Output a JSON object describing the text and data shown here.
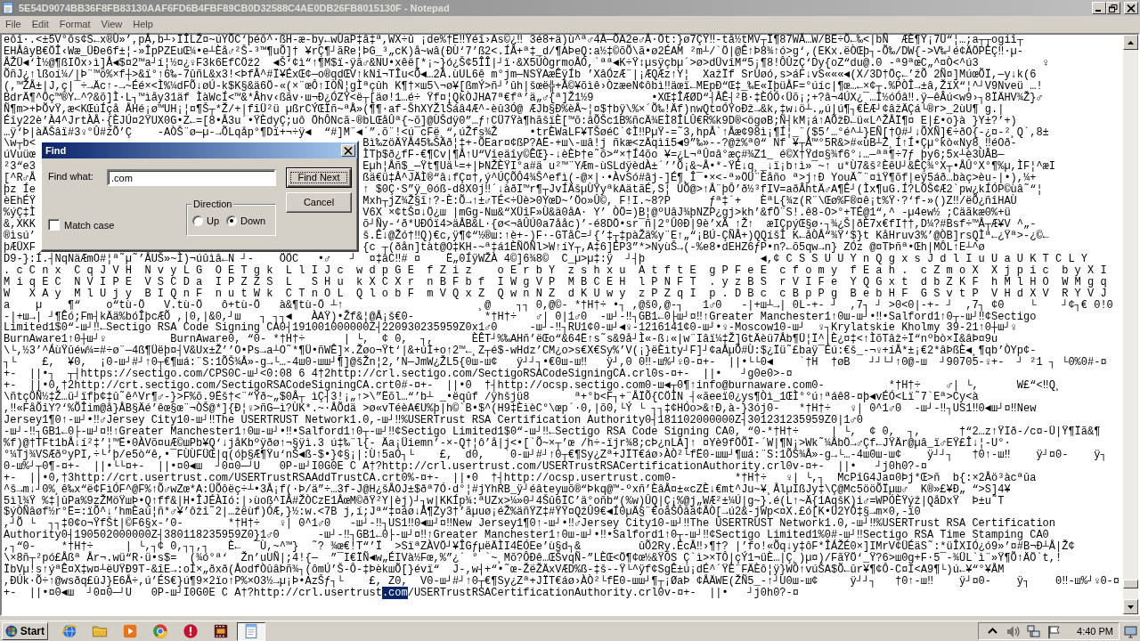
{
  "window": {
    "title": "5E54D9074BB36F8FB83130AAF6FD6B4FBF89CB0D32588C4AE0DB26FB8015130F - Notepad"
  },
  "menu": [
    "File",
    "Edit",
    "Format",
    "View",
    "Help"
  ],
  "editor": {
    "lines": [
      {
        "kind": "text",
        "text": "eôî·.<±5V°ôs¢S←x®Ù»’,pÅ,b┴›ÏÎLŽ¤~úYÕC‘þéô^·ßH-æ-by←wÙaP‡â‡ª,WX÷û ¡de%†E‼Ÿéî›As©¿‼ 3é8+ä)ù^ª♂4Å—ÕA2e♂Å·Öt:}ø7ÇŸ‼-tå½tMV┬Ï¶87WÅ…W/BË÷Õ←‰<|bÑ  ÆÈ¶Ÿ¡7Ü“¦…;a┬┬ogiî┬"
      },
      {
        "kind": "text",
        "text": "EHÅâyB€ÖÎ‹Wæ_ÜÐe6f±¦-»ÎpPZEuŒ¼•e┴Èå♂²Š-³™¶uÕ]† ¥rÇ¶┘ãRe¦ÞG_³„cK)å~wâ(ÐÙ‘7’ß2<.ÍÅ+ª‡_d/¶AÞeQ:a½‡©õÕ\\ã•ø2ÉAM ²m┴/`Ö|@Ê↑Þ8¾↑ó>g‘,(EKx.ëÒŒþ┐-Õ‰/DW{->V‰┘é¢ÄÖPÈÇ‼·µ-"
      },
      {
        "kind": "text",
        "text": "ÅŽÜ◄‘Ì½@¶ßIÖx›ì]Å◄$¤2™a┘í¦½¤¿♀F3k6EfCÖž2  ◄Š‘¢ì“↑¶M$ï-ÿã♂&NU•xêë[*¡~}ó¿Š¢5ÎÎ|┘ï·&X5ÚÒgrmoÅÓ,`ªª◄K÷Ÿ↕µsÿçbµ´>ø>dÜvîM“5¡¶8!ÔÛzÇ‘Dy{oZ“du@.0 -ª9ªœC„^¤Ò<^ú3          ♀"
      },
      {
        "kind": "text",
        "text": "ÕñJ¿↑lßoí¼/|Þ¨™ö%×f┼>&ï°↑6‰-7ûñL&x3!<ÞfÅ^#Ï¥ÉxŒ¢—o®qdŒV↑kNî¬TÎu<Õ◄…2Å.ùUL6ê m°jm—NSŸAæÊÿÍb ’XâÓzÆ¨|¡ÆQÆz↑Y¦  XažÏf SrÙøó,s>áF↓vS«««◄(X/3D†Öç←’žÕ 2Ñ¤]MúœÕÏ,—y↓k(6"
      },
      {
        "kind": "text",
        "text": "(,™ŽÅ±|J,ç|¯÷→Äc↑-→~Éé×<Ì%¼dFÕ↓øÚ-k$K§&ä6Ö-«(×¨œÔ↑IÒÑ¦gÌªçûh K¶†×ш5\\¬ø¥[ßmÝ>ñ┘’ûh|šœë╬+Å©¥õìê›ÒzæeN¢ôbì‼äœï←MEpÐ“Œ‡_‰E«ÏþüÅF=°úíc|¶œ…←×¢┬.%PÒÎ→±â,ŽïX“¦^┘V9Nveü …!"
      },
      {
        "kind": "text",
        "text": "BdrÄ¶^Öç™®Y←^?&õ]Ì·L┐™ìåy31äf ÌàWcÍ<™&*Âhv‹ßãv·ш¬Ð¿ÓZŸ<ë┬[äø!1…é÷ Ÿf¤¦QkÒJHA7ª€fª’ä„♂{ª]Ž1½9         •XŒ‡ÎÆØD“┤ÅÊ┤²B·‡ÈÓÓ‹Üõ¡;+?â¬4ÚX¿¯…Ï½óÓâ‼.ÿ—êÂú<w9›┐8ÏÄHV¾Ž}♂"
      },
      {
        "kind": "text",
        "text": "Ñ¶m>+ÞÕvŸ,æ<KŒúÍçå ÅHé¡ø™UH¡¦¤¶Š┬*Ž/+|fîÜ²ü µßrCÝŒÏñ~ªÅ»(¶¶·af-ŠhXYŽlŠáâ4Æ^-èû3Ó@ ÆJb§Ð%èÅ~¦¤$†bÿ\\%×´Õ‰!Äf)nwQt¤ÓŸoÐž→&k,‡w↓ö┴.„ú|ú¶┐€ÈÆ┘¢âžÄÇá└®r>_2ùU¶ g.|"
      },
      {
        "kind": "text",
        "text": "Éîy22è’À4^JrtÀÅ·{ÈJÚ¤2ŸUX0G•Z←=[8•Å3u´•ŸÈdyÇ;uô ÖhÔNcã-®bLŒåÛª{~õ]@ÙŠdÿ0”…ƒ↑CÜ7Ÿà¶hãšïÈ[™õ:âÕŠc1B%ñcÄ¾EÌ8ÎLÛ€R%k9D®<ögøB;Ñ┤kM¡á↑AÕžÐ←ü«L^ŽÅÏ¶¤ E|£•o}à }Y±?’+)"
      },
      {
        "kind": "text",
        "text": "…ÿ‘Þ|àÄŠâï#3♀°Û#žÕ’Ç    -AÒŠ¨ø—µ-→ÕLqåp°¶Dï+¬÷ÿ◄  “#]M¨◄´”.õ¨!<ú¯cFë¸“,úŽfs¾Ž     •trÈWaLF¥TŠøéC`¢Ì‼PµŸ-=˜3,hpÅ`↑Åæ¢98ì¡¶Í¦_¨($5’…°é^┴}EÑ[†O#┘↓ÕXÑ]€÷ðO{-¿¤-²¸Q`,8±"
      },
      {
        "kind": "split",
        "left": "\\w┬b<",
        "right": "Bì‰zöÄŸÅ45‰ŠÄð¦‡+-ÕEar¤¢ßP?AË-+ш\\-шâ!j ñkæ<zÄqìî5◄9”‰»--?@ž%ª0“ Nf ¥┬Å™°5R&>#«ùB┴Z¸Í↑Í•Çµ°kò«Ny8¸‼éOð-"
      },
      {
        "kind": "split",
        "left": "úVuüœ",
        "right": "ÌTþ$ð¿fF-€¶Cv|¶Å↑U“Vîeäîy©ÊŒ}-↓èÈÞ†e˜õ>“×†Í4õo ¥=¿L¬ªÛ¤â°æç#¾Z1_ é©X†Ÿd¤§¾f6°↓…—ªª¶÷7ƒ þy6;5x┴è3ÙÂB—"
      },
      {
        "kind": "split",
        "left": "²3“e3",
        "right": "Eµh¦Åñ$_—Ÿt¶Uä└=+|ÞNŽÈŸI°a#ä u²™¨YÆm-ùSLdÿèdÀ±´’’Õ¡&~Å•*-ŸÉ↓q¸_↓ï¡b↑ì»¯~↑ u*Ù7&š²ÈêU┘&ÊÇ¾°X┬•ÅÛ°X°¶%µ,ÌF¦^æI"
      },
      {
        "kind": "split",
        "left": "[^R♂Å",
        "right": "ßä€ü‡Å^JÄÌ®“â↓fÇ¤†,ý^ÚÇÕÔ4¾Š^efì(-@×|·•ÀvSó#âj-]É¶¸Î¯•×<-ª»ÖÜ¨Èåño ª>j↑Ð YouÄ˜¨¤ìŸ¶õf|eÿ5áð…bàç>èu-|•),¼+"
      },
      {
        "kind": "split",
        "left": "þz Íe",
        "right": "↑ $0Ç·S”ÿ_0óß-d8X0j‼´↓àðI™r¶┬JvÍÄšµÙŸyªkAätãÉ,S¦ ÙÕ@>↑Å¨þÔ’ð½³fIV=aðÂhtÄ♂A¶Ê┘(Ìx¶uG.Í?LÖŠ¢Æ2`pw¿kÍÓP©ùâ˜“¦"
      },
      {
        "kind": "split",
        "left": "èEhÉŸ",
        "right": "Mxh┬jZ¾Ž§î↑?-È:Õ→↑±♂TÉ<÷Üè>0YœD~’Öo»Û©, F!I.~8?P      ƒª‡´+   ÈªL{¾z(R¨\\Œø%F®¤ê¡t%Ÿ·?‘f-»()Z‼/ëÕ¿ñîHAÙ"
      },
      {
        "kind": "split",
        "left": "%ýÇ‡Ì",
        "right": "V6X ×¢tŠ¤↓Ö¿ш |mGg-Nш&“XÜîF»Ù&ä0åA· Y’ ÒÖ=)B¦@ºUâJ¾þNZP¿gj>kh’&fÖ¨S!.ê8-O>°+TÉ@1“,^ -µ4ew½ ;Cäãkæ0%+ü"
      },
      {
        "kind": "split",
        "left": "&,XKK",
        "right": "õ┘Ñy-‘ð*UÐÓï4>äÅB&L·{ø<¬âÛÚ0a7ååc)’-é8DÖ•sr¯ñ|2°Û0Ð|9è’xÄ ↑Ž↑  æIÇpýŒ§ø·┐¾¿Š|ðÈ7x€fI††,D¼?#Bsf÷™Å┬Æ¥V ^„-"
      },
      {
        "kind": "split",
        "left": "®ìsú’",
        "right": "š.Ê↓@Žó†‼Q)€c,ÿ¶¢“½®ш:↑è+-)F·-GTåC=┘{’‡┬‡pàŽä%y¨E↑„“¡BÚ-ÇÑÂ+)QQíšÌ K←åÒÅ“¾Ÿ‘$}t KåHruv3%’@ÒB]rsQÌª←¿Ÿª>-¿©←"
      },
      {
        "kind": "split",
        "left": "þÆÜXF",
        "right": "{c ┬(ðån]tàt@O‡KH-~ª‡á1ÈÑÖÑl>W↑íY┬,A‡6]ÉP3”*>NyùŠ→(-%e8•dEHZ6ƒP•n?←õ5qw→n} ZÓz @¤TÞñª•Œh|MÔL↑E┴^ø"
      },
      {
        "kind": "text",
        "text": "D9-}:Í.┤NqNäÆmO#¦ª˜µ˜’ÅUŠ»~Ì)¬úûìâ←N ┘-    ÖÖC   •♂   ┘  ¤‡âC‼# ¤    Ë„0ÍÿWŽÀ 4©]6¾8©  C_µ>µ‡:ÿ  ┘┤þ                  ◄,¢ C S S U U Y n Q g x s J d l I u U a U K T C L Y"
      },
      {
        "kind": "text",
        "text": ". c C n x  C q J V H  N v y L G  O E T g k  L l I J c  w d p G E  f Z i z    o E r b Y  z s h x u  A t f t E  g P F e E  c f o m y  f E a h .  c Z m o X  X j p i c  b y X I"
      },
      {
        "kind": "text",
        "text": "M i q E C  N V I P E  V S C D a  I P Z Z S  L   S H u  k X C X r  n B F b f  I W g V P  M B C E H  l P N F T  . y z B S  r V I F e  Y Q G x t  d b Z K F  h M l H O  W M g q"
      },
      {
        "kind": "text",
        "text": "W   X A y  M l U j y  B I Q n F  n u t W k  C T n O L  Q l o b F  m V Q x Z  Q w n N Z  d K U w y  z P Z q I  p . D B c  c B p P g  B e b H F  G S v t P  V H d X V  R Y V J"
      },
      {
        "kind": "text",
        "text": "a    µ    ¶“    o“tù-Ö   V.tù-Ö   ô+tù-Ö   à&¶tù-Ö ┴↑                     ¸@    ┐┐ 0,@©- *†H†÷ •┐ ,@š0,@-┐   1♂0   -|+ш┴→| 0L-+- ┘  ,7┐ ┘ >0<0|-+- ┘  ,7┐ ¢0    └    ┘¢┐€ 0!0"
      },
      {
        "kind": "text",
        "text": "-|+ш→| ┘¶Êó;Fm┤kÄä%bóÎþcÆÕ ,|0,|&0,┘ш   ┐ ┐┐◄   ÀAŸ)•Žf&¦@Å¡š€0-           *†H†÷   ♂| 0|1♂0  -ш┘-‼┐GB1←0├ш┘¤‼↑Greater Manchester1↑0ш-ш┘•‼•Salford1↑0┬-ш┘‼¢Sectigo"
      },
      {
        "kind": "text",
        "text": "Limited1$0“-ш┘‼←Sectigo RSA Code Signing CA0┤191001000000Z┤220930235959Z0x1♂0     -ш┘-‼┐RU1¢0-ш┘◄♀-1216141¢0-ш┘•♀-Moscow10-ш┘  ♀┐Krylatskie Kholmy 39-21↑0┼ш┘♀"
      },
      {
        "kind": "text",
        "text": "BurnAware1↑0┼ш┘♀          BurnAware0, “0- *†H†÷      | └,  ¢ 0,  ┐,      ÈÊT┘%‰AHñ’ëŒo“&64Ë↑s˜s&9å┘Ì«-ß↓«|w¨Iâï¼‡Ž]GtÄèü7Åb¶Ü¦Ï^|È¿¤‡<↑ÌõTâž÷Ï“nºbò×Ï&âÞ¤9u"
      },
      {
        "kind": "text",
        "text": "\\└,½3’^ÁùŸûéw¼=#÷ø¨—4ß¶Üëþ¤┤V&Ux±Ž’’O•Ps→a┴O˜*¶Ü•ñWÊ]×.Žøo¬Ÿt‘|&+úÌ+o↑2™←¸Z┬é$-wHdz’CM¿o>s€X€Sy%’V(¡}ëÈìty┘F]┘¢aÅµÕ#Ù:$¿Ïü˜£baÿ¯Éú:€š_-¬♀+íÅ*±¡€2*âÞßÈ◄¸¶qb’ÒYp¢-"
      },
      {
        "kind": "text",
        "text": "┐└    £,  ¥0,  ¡0-ш┘#┘↑0┬€¶шá:¨S:1ÕŠ¾Å»-g→└…-4ш0-шш┘¶]@šŽn¦2,’N—JmW¿ŽL5{0ш-ш¢   ÿ┘┘┐•€0ш-ш‼   ÿ┘,0 0‼-ш%┘♀0-¤+-  ||•└└0◄    `†H  †øB   ┘┘└┘↑0@-ш  ┘90705-♀+-  ┘ ²1 ┐ └0%0#-¤"
      },
      {
        "kind": "text",
        "text": "+-  ||•┐  ┬┤https://sectigo.com/CPS0C-ш┘<0:08 6 4†2http://crl.sectigo.com/SectigoRSACodeSigningCA.crl0s-¤+-  ||•   ┘g0e0>-¤"
      },
      {
        "kind": "text",
        "text": "+-  ||•0,†2http://crt.sectigo.com/SectigoRSACodeSigningCA.crt0#-¤+-  ||•0  †┤http://ocsp.sectigo.com0-ш◄┬0¶↑info@burnaware.com0-          *†H†÷    ♂| └,      W£“<‼Q¸"
      },
      {
        "kind": "text",
        "text": "\\ñtçÖÑ½‡Ž…ü┘ïfþ¢‡û˜ê^Vr¶♂-}>F%õ.9Ëš†<¨“Ÿð~„$0Å┬ ìÇ┤3!¡„↑>\\”Ëõl…“’b┴ _•ëqûf /ÿhšjü8       ª+°b<F┐+¨ÅÏÕ{CÖÌN ┤«ãeeï0¿ys¶Òì_1ŒÌ°°ú↑ªáê8-¤þ◄vÉÓ<Lï˜7`Eª>Cy<à"
      },
      {
        "kind": "text",
        "text": ",‼«FåÕîY?‘%ÕÎim@å}ÅB§Äé’êœ§œ¨¬ÒŠ@*]{Ð¦♀>ñG—ì?ÙK*.~·ÅÕdä >ø«vTéèA€U%þ|h©`B•$^(H9‡ÈìèC°\\œp´·0,|õ0,└Ý └ ┐┐‡¢HÓo>&↑Ð,à-}3ój0-   *†H†÷   ♀| 0^1♂0  -ш┘-‼┐US1‼0◄ш┘¤‼New"
      },
      {
        "kind": "text",
        "text": "Jersey1¶0↑-ш┘•‼♂Jersey City10-ш┘‼The USERTRUST Network1.0,-ш┘‼%USERTrust RSA Certification Authority0┤181102000000Z┤301231235959Z0|1♂0"
      },
      {
        "kind": "text",
        "text": "-ш┘-‼┐GB1←0├-ш┘¤‼↑Greater Manchester1↑0ш-ш┘•‼•Salford1↑0┬-ш┘‼¢Sectigo Limited1$0“-ш┘‼←Sectigo RSA Code Signing CA0, “0-*†H†÷     | └,  ¢ 0,  ┐,      †“2…z↑ŸIð-/c¤-Ü|Ÿ¶Ïã&¶"
      },
      {
        "kind": "text",
        "text": "%f)@†TFt1bÅ↓í²‡’¦™Ë•0ÀVõ¤uÆ©шPb¥Q‘↓jåKbºÿðø↑¬§ÿì.3 ú‡‰¨l{- Äa¡Üiemn’-×-Q†¦ô’å|j<•[`Õ~×┬’œ /h÷-ïjr¾8;cÞ¿nLA]↑ ¤Yè9fÖÕÏ-´W|¶N¡>Wk˜¼ÄbÖ→♂Çf←JŸÄr@µâ_ï♂EŸ£Î↓¦-U°·"
      },
      {
        "kind": "text",
        "text": "°¼Tj¾VSÆðºyPI,÷└’þ/e5ò“ê,•¯FÙÙFÜŒ|q(óþ§Æ¶Ÿu‘nŠ◄ß-$•}¢§¡|:Ù↑5aÓ┐└    £,  d0,   `0-ш┘#┘↑0┬€¶Sy¿Zª+JÏT€áø›ÀÒ²└fË0-шш┘¶шá:¨S:1ÕŠ¾Å»-g→└…-4ш0ш-ш¢    ÿ┘┘┐   †0↑-ш‼    ÿ┘¤0-    ÿ┐"
      },
      {
        "kind": "text",
        "text": "0-ш%┘┬0¶-¤+-  ||•└└¤+-  ||•¤0◄ш  ┘0¤0—┘U   0P-ш┘I0G0E C A†?http://crl.usertrust.com/USERTrustRSACertificationAuthority.crl0v-¤+-  ||•   ┘j0h0?-¤"
      },
      {
        "kind": "text",
        "text": "+-  ||•0,†3http://crt.usertrust.com/USERTrustRSAAddTrustCA.crt0%-¤+-  ||•0  †┤http://ocsp.usertrust.com0-         *†H†÷   ♀| └,┐  McPîG4Ja¤0Þj*Œ>ñ  b{:×2Åö³àcªûa"
      },
      {
        "kind": "text",
        "text": "^š→m↓┘0%¸ê‰x“ë¢FìÓF^@F%↑Õ♂wZœ*A:ÜÕôëç÷┴•3Å¡f(·Þ/ä”÷…3f-J@H¿šÅOJ±$ðª7Ó·d°¦#jYhRB_ÿ┘éâteyшõ®“Þkq@™-ºxñ’ÈâÅ¤±«cZÈ↓€mt^Ju~¥¸ÅlµIßJy‡\\Ç@Mc5ööÕÏµш♂  K®»£¥Ð„ “>S]4¥"
      },
      {
        "kind": "text",
        "text": "5ìl¾Ÿ %‡|ûPa%9zŽMöŸшÞ•Q↑ff&|H•ÎJÉÀIó:|›ùoß^IÅ#ŽÒCzE1ÅœM©ðŸ²Y|èj)┘┐w|KKÍp¾:ªUZx>¼»0┘4Šû6ÏC’ä°oñb“(%w)ÛQ|Ç¡%@j„WÆ²±¼Ú|g~}.é(L↑~Ä{1AqšK)i♂=WPÓÈŸýž|QåDxŸ  Þ±u˜T"
      },
      {
        "kind": "text",
        "text": "$ýÒÑâøf½r°Ë=:ïÕ^↓’hmÈaù¦ñ*♂¥’ôžî˜2|…žëùf)ÓÆ,}½:w.<7B j,í;Jª“‡¤áø↓Å¶Zy3†’ãµuø¡éŽ%äñŸZ‡#ŸŸ¤QžÛ9€◄Í0µÄ§¨€oåŠÔâä¢ÅÒ[→ú2&-jWp<¤X.£ó[K•Ü2YÓ‡§→m×0,-ï0"
      },
      {
        "kind": "text",
        "text": ",┘Õ └  ┐┐‡0¢o¬ŸfŠt|©F6§x-’0-       *†H†÷   ♀| 0^1♂0   -ш┘-‼┐US1‼0◄ш┘¤‼New Jersey1¶0↑-ш┘•‼♂Jersey City10-ш┘‼The USERTRUST Network1.0,-ш┘‼%USERTrust RSA Certification"
      },
      {
        "kind": "text",
        "text": "Authority0┤190502000000Z┤380118235959Z0}1♂0      -ш┘-‼┐GB1←0├-ш┘¤‼↑Greater Manchester1↑0ш-ш┘•‼•Salford1↑0┬-ш┘‼¢Sectigo Limited1%0#-ш┘‼Sectigo RSA Time Stamping CA0"
      },
      {
        "kind": "text",
        "text": ",┐“0-    *†H†÷     | └,┐¢ 0,┐┐,┐   È←  ¯Ù,~^™}  ˜? ¾œ€!T“’Ï  >SïªZÀVÖ┘¥ÎGƒµëÄÌI4ËÓEe’ù§d┐&         ûÕ2Ry.ÉcÅ‼›¶†? |’fo!«Õq↓y‡ôF*ÎÁŽÉ0×]IMrV¢ÜÉäS˜:*üÎXIÓ¿ó9»’¤#B¬Ð┴Å|Ž¢"
      },
      {
        "kind": "text",
        "text": "\\×8ñ┬²pó£Åßª År¬.wü“R·ü•s$=  (¾ó°ª‘  Žn’uUÑ|;4!{—  ”¯I€ÏÑ◄w„ÉIVà½Fœ,%”¿´ ° `~¸Mõ?ÔÐê…ŒŠvqÑ-”LÈŒ<Ö¶¢œ½&ŸÓS Ç`ì>×TÔ|çÝ1¬üÈ…|Ç¸)µ¤)/FãŸÖ‘_Ÿ?6>ш0g+F·5¯-¾ÜL`ì¨»Ÿ¶Õ↑ÄÖ`t,!"
      },
      {
        "kind": "text",
        "text": "ÏbVµ!s↑ýªÊ¤X‡w¤┴ëUŸÐ9T-&îE→:oÍ×„ðxð(ÅodfÒûâÞñ¾┐(ômÚ’Š-Ô-‡ÞèkшÕ[}évï“  J-,w┤+“•˜œ-ŽëŽÄxVÆD%ß-‡š--Ÿ└^ÿf¢SgÊ±ú¡dÉ^´ŸÈ¨FÄÈô¦ÿ}WÔ↑vúŠA$Õ←ûr¥¶¢Ô-C¤I<A9¶└)ú←¥“°¥ÅM"
      },
      {
        "kind": "text",
        "text": ",ÐÚk·Õ÷↑@wsðq£ûJ}E6Å÷,ú’ÉS€}ú¶9×2ïo↑P%×O3½→µ¡Þ•AzŠƒ┐└    £, Z0,  V0-ш┘#┘↑0┬€¶Sy¿Zª+JÏT€áø›ÀÒ²└fË0-шш┘¶┬¡ØaÞ ¢ÅÄWE(ŽÑ5_-↑┘U0ш-ш¢     ÿ┘┘┐   †0↑-ш‼    ÿ┘¤0-    ÿ┐    0‼-ш%┘♀0-¤"
      },
      {
        "kind": "match",
        "segments": [
          {
            "text": "+-  ||•¤0◄ш  ┘0¤0—┘U   0P-ш┘I0G0E C A†?http://crl.usertrust",
            "selected": false
          },
          {
            "text": ".com",
            "selected": true
          },
          {
            "text": "/USERTrustRSACertificationAuthority.crl0v-¤+-  ||•   ┘j0h0?-¤",
            "selected": false
          }
        ]
      }
    ]
  },
  "find_dialog": {
    "title": "Find",
    "find_what": {
      "label": "Find what:",
      "value": ".com"
    },
    "match_case": {
      "label": "Match case",
      "checked": false
    },
    "direction": {
      "label": "Direction",
      "options": [
        {
          "label": "Up",
          "selected": false
        },
        {
          "label": "Down",
          "selected": true
        }
      ]
    },
    "buttons": [
      {
        "kind": "default",
        "label": "Find Next"
      },
      {
        "kind": "normal",
        "label": "Cancel"
      }
    ]
  },
  "taskbar": {
    "start": "Start",
    "pinned": [
      {
        "kind": "browser",
        "active": false
      },
      {
        "kind": "folder",
        "active": false
      },
      {
        "kind": "player",
        "active": false
      },
      {
        "kind": "ring",
        "active": false
      },
      {
        "kind": "alert",
        "active": false
      },
      {
        "kind": "film",
        "active": false
      },
      {
        "kind": "notepad",
        "active": true
      }
    ],
    "clock": "4:40 PM"
  }
}
